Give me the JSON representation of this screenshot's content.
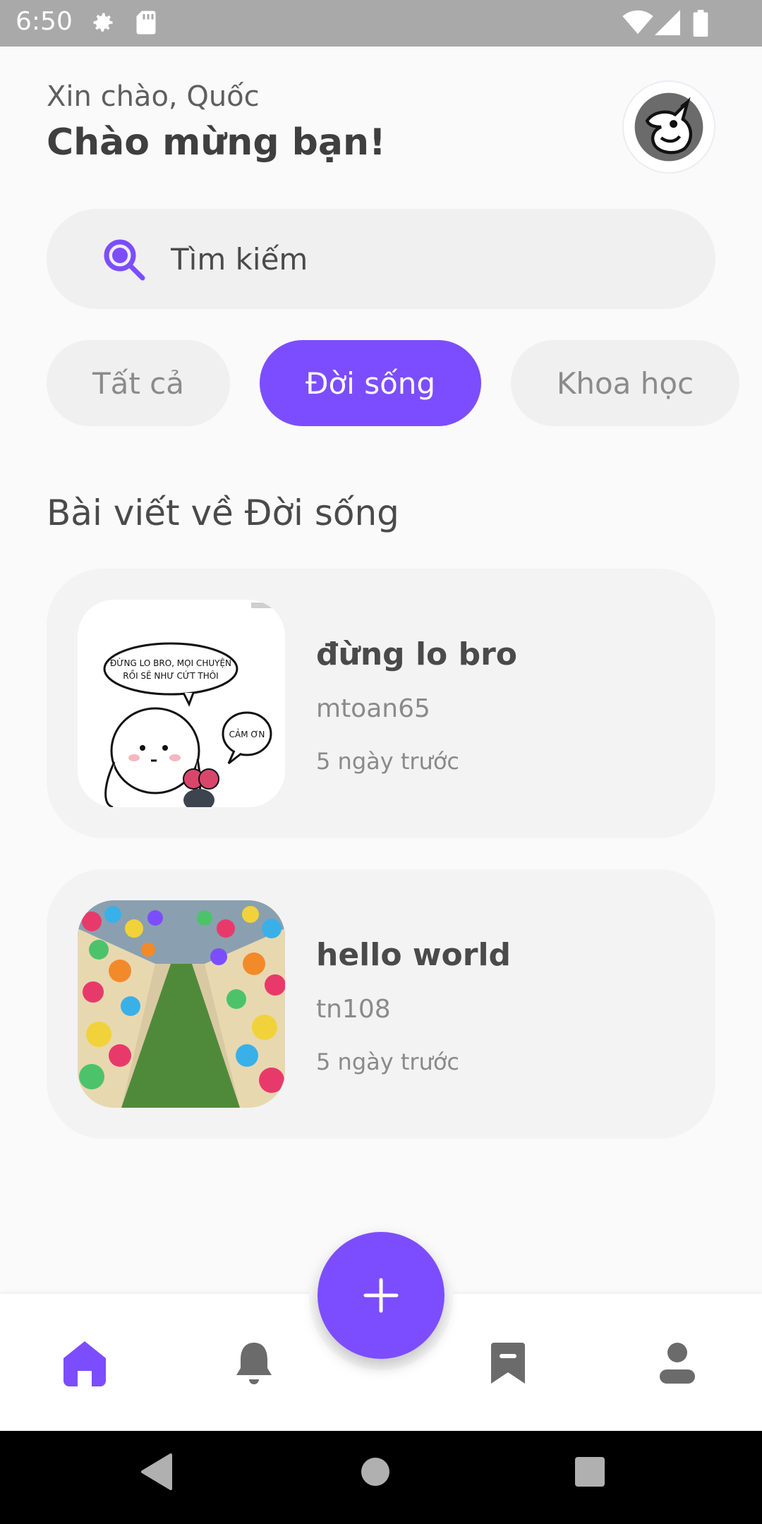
{
  "status_bar": {
    "time": "6:50",
    "icons": [
      "gear-icon",
      "sd-card-icon",
      "wifi-icon",
      "signal-icon",
      "battery-icon"
    ]
  },
  "header": {
    "greeting": "Xin chào, Quốc",
    "welcome": "Chào mừng bạn!",
    "avatar_icon": "unicorn-avatar-icon"
  },
  "search": {
    "placeholder": "Tìm kiếm",
    "icon": "search-icon"
  },
  "categories": [
    {
      "label": "Tất cả",
      "selected": false
    },
    {
      "label": "Đời sống",
      "selected": true
    },
    {
      "label": "Khoa học",
      "selected": false
    }
  ],
  "section_title": "Bài viết về Đời sống",
  "posts": [
    {
      "title": "đừng lo bro",
      "author": "mtoan65",
      "time": "5 ngày trước",
      "image": "comic-thumbnail",
      "comic_text_1": "ĐỪNG LO BRO, MỌI CHUYỆN",
      "comic_text_2": "RỒI SẼ NHƯ CỨT THÔI",
      "comic_reply": "CẢM ƠN"
    },
    {
      "title": "hello world",
      "author": "tn108",
      "time": "5 ngày trước",
      "image": "pinwheel-path-photo"
    }
  ],
  "bottom_nav": {
    "items": [
      "home-icon",
      "bell-icon",
      "bookmark-icon",
      "profile-icon"
    ],
    "fab": "plus-icon"
  },
  "colors": {
    "accent": "#7c4dff",
    "background": "#fafafa",
    "card": "#f3f3f3",
    "chip": "#f0f0f0"
  }
}
